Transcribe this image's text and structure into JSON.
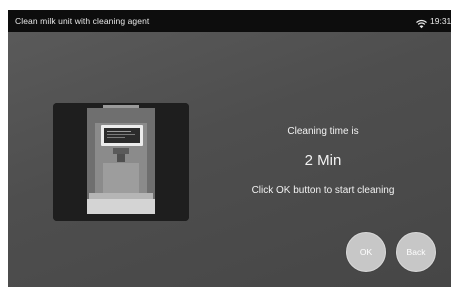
{
  "status_bar": {
    "title": "Clean milk unit with cleaning agent",
    "time": "19:31",
    "wifi_icon": "wifi-icon"
  },
  "main": {
    "illustration": "coffee-machine-illustration",
    "label": "Cleaning time is",
    "time_value": "2 Min",
    "instruction": "Click OK button to start cleaning"
  },
  "buttons": {
    "ok_label": "OK",
    "back_label": "Back"
  },
  "colors": {
    "status_bar_bg": "#0d0d0d",
    "screen_bg": "#4e4e4e",
    "button_bg": "#c7c7c7"
  }
}
